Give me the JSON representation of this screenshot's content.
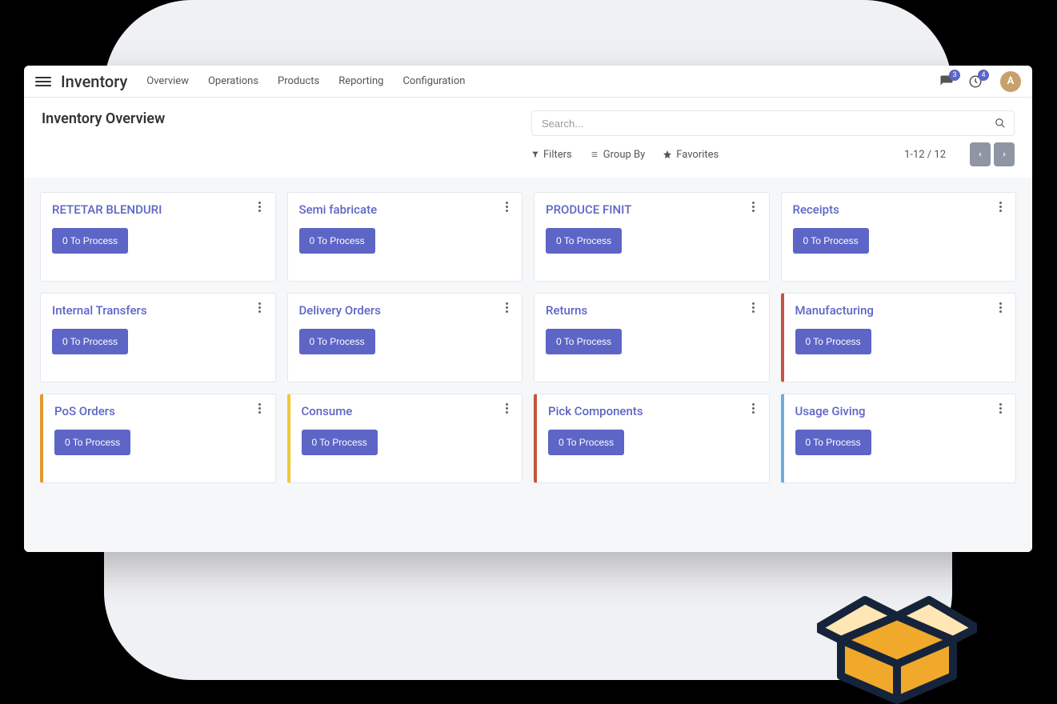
{
  "app": {
    "title": "Inventory",
    "nav": [
      "Overview",
      "Operations",
      "Products",
      "Reporting",
      "Configuration"
    ],
    "chat_badge": "3",
    "activity_badge": "4",
    "avatar_initial": "A"
  },
  "page": {
    "title": "Inventory Overview",
    "search_placeholder": "Search...",
    "filters_label": "Filters",
    "groupby_label": "Group By",
    "favorites_label": "Favorites",
    "range": "1-12 / 12"
  },
  "cards": [
    {
      "title": "RETETAR BLENDURI",
      "button": "0 To Process",
      "accent": ""
    },
    {
      "title": "Semi fabricate",
      "button": "0 To Process",
      "accent": ""
    },
    {
      "title": "PRODUCE FINIT",
      "button": "0 To Process",
      "accent": ""
    },
    {
      "title": "Receipts",
      "button": "0 To Process",
      "accent": ""
    },
    {
      "title": "Internal Transfers",
      "button": "0 To Process",
      "accent": ""
    },
    {
      "title": "Delivery Orders",
      "button": "0 To Process",
      "accent": ""
    },
    {
      "title": "Returns",
      "button": "0 To Process",
      "accent": ""
    },
    {
      "title": "Manufacturing",
      "button": "0 To Process",
      "accent": "red"
    },
    {
      "title": "PoS Orders",
      "button": "0 To Process",
      "accent": "orange"
    },
    {
      "title": "Consume",
      "button": "0 To Process",
      "accent": "yellow"
    },
    {
      "title": "Pick Components",
      "button": "0 To Process",
      "accent": "red"
    },
    {
      "title": "Usage Giving",
      "button": "0 To Process",
      "accent": "blue"
    }
  ]
}
